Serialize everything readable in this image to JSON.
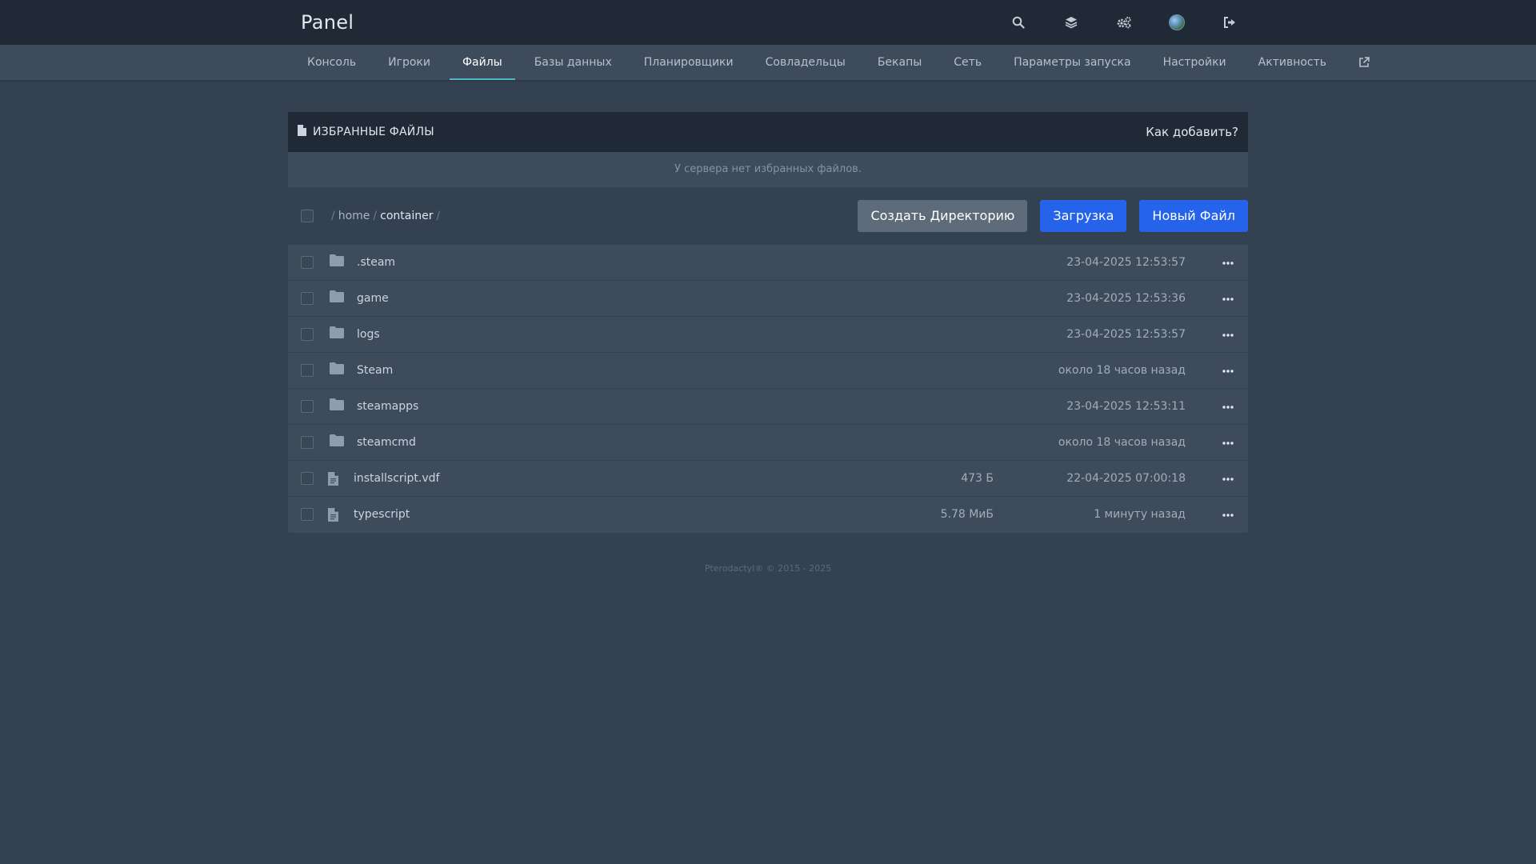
{
  "app": {
    "brand": "Panel"
  },
  "topbar_icons": [
    "search-icon",
    "layers-icon",
    "settings-cogs-icon",
    "user-avatar",
    "logout-icon"
  ],
  "nav": {
    "items": [
      {
        "label": "Консоль",
        "active": false
      },
      {
        "label": "Игроки",
        "active": false
      },
      {
        "label": "Файлы",
        "active": true
      },
      {
        "label": "Базы данных",
        "active": false
      },
      {
        "label": "Планировщики",
        "active": false
      },
      {
        "label": "Совладельцы",
        "active": false
      },
      {
        "label": "Бекапы",
        "active": false
      },
      {
        "label": "Сеть",
        "active": false
      },
      {
        "label": "Параметры запуска",
        "active": false
      },
      {
        "label": "Настройки",
        "active": false
      },
      {
        "label": "Активность",
        "active": false
      }
    ],
    "external_icon": "external-link-icon"
  },
  "favorites": {
    "title": "ИЗБРАННЫЕ ФАЙЛЫ",
    "help_link": "Как добавить?",
    "empty_message": "У сервера нет избранных файлов."
  },
  "breadcrumb": {
    "segments": [
      "home",
      "container"
    ]
  },
  "actions": {
    "create_dir": "Создать Директорию",
    "upload": "Загрузка",
    "new_file": "Новый Файл"
  },
  "files": [
    {
      "name": ".steam",
      "type": "folder",
      "size": "",
      "modified": "23-04-2025 12:53:57"
    },
    {
      "name": "game",
      "type": "folder",
      "size": "",
      "modified": "23-04-2025 12:53:36"
    },
    {
      "name": "logs",
      "type": "folder",
      "size": "",
      "modified": "23-04-2025 12:53:57"
    },
    {
      "name": "Steam",
      "type": "folder",
      "size": "",
      "modified": "около 18 часов назад"
    },
    {
      "name": "steamapps",
      "type": "folder",
      "size": "",
      "modified": "23-04-2025 12:53:11"
    },
    {
      "name": "steamcmd",
      "type": "folder",
      "size": "",
      "modified": "около 18 часов назад"
    },
    {
      "name": "installscript.vdf",
      "type": "file",
      "size": "473 Б",
      "modified": "22-04-2025 07:00:18"
    },
    {
      "name": "typescript",
      "type": "file",
      "size": "5.78 МиБ",
      "modified": "1 минуту назад"
    }
  ],
  "footer": {
    "text": "Pterodactyl® © 2015 - 2025"
  },
  "colors": {
    "background": "#334150",
    "topbar": "#1f2a36",
    "subnav": "#3d4b5a",
    "accent_tab": "#4fb4c8",
    "primary_button": "#2563eb",
    "secondary_button": "#5d6b7a"
  }
}
